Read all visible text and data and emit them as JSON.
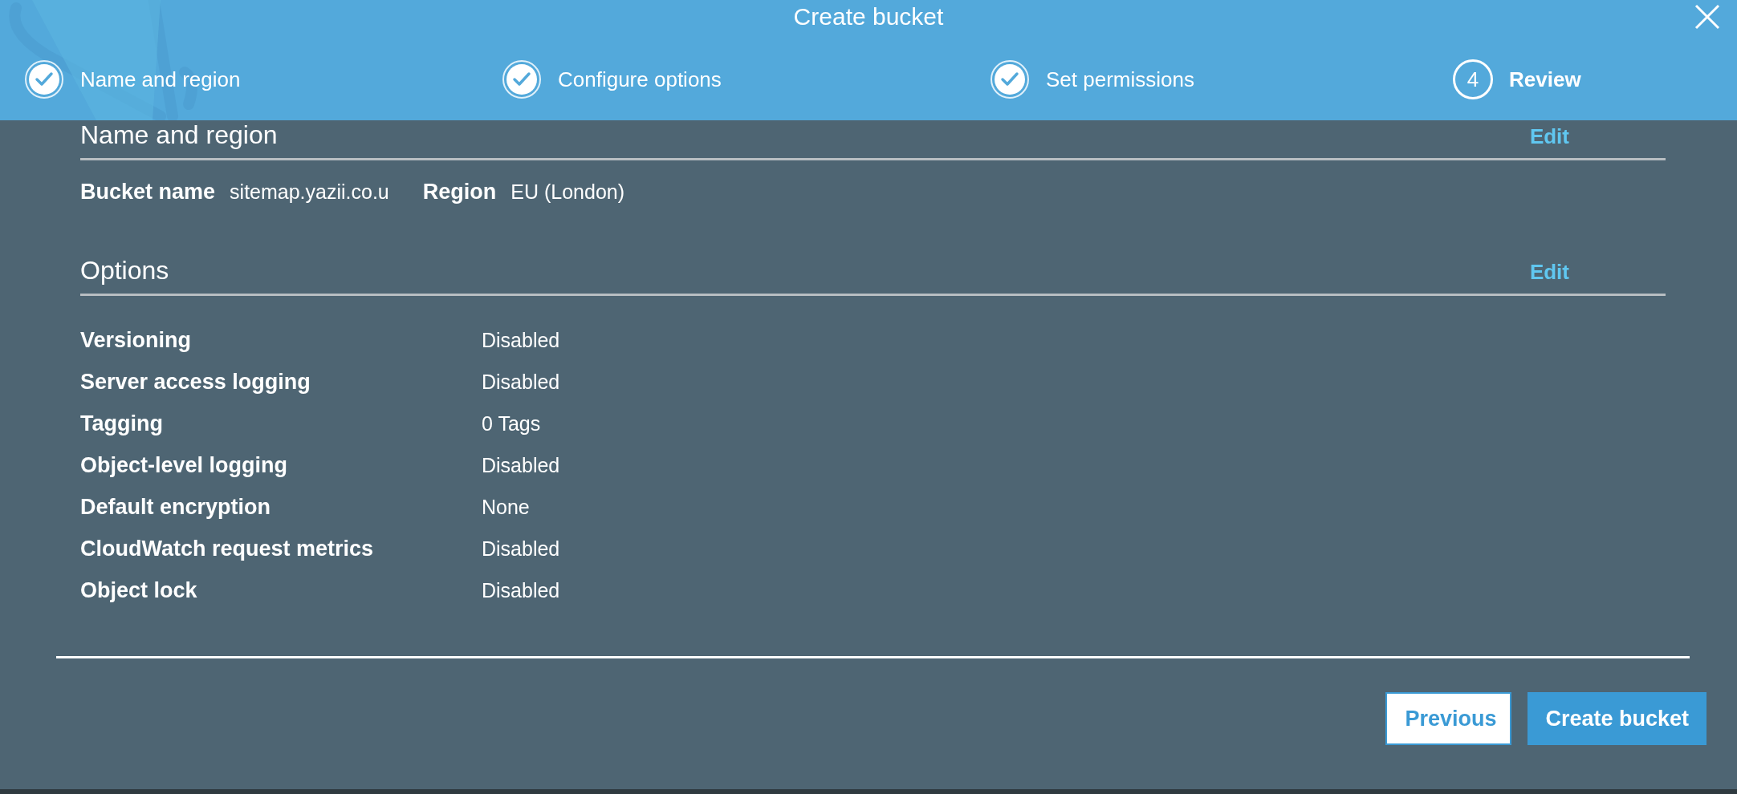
{
  "dialog": {
    "title": "Create bucket"
  },
  "steps": [
    {
      "label": "Name and region",
      "completed": true,
      "selected": false
    },
    {
      "label": "Configure options",
      "completed": true,
      "selected": false
    },
    {
      "label": "Set permissions",
      "completed": true,
      "selected": false
    },
    {
      "label": "Review",
      "completed": false,
      "selected": true,
      "number": "4"
    }
  ],
  "sections": [
    {
      "kind": "inline",
      "heading": "Name and region",
      "edit": "Edit",
      "fields": [
        {
          "label": "Bucket name",
          "value": "sitemap.yazii.co.u"
        },
        {
          "label": "Region",
          "value": "EU (London)"
        }
      ]
    },
    {
      "kind": "table",
      "heading": "Options",
      "edit": "Edit",
      "fields": [
        {
          "label": "Versioning",
          "value": "Disabled"
        },
        {
          "label": "Server access logging",
          "value": "Disabled"
        },
        {
          "label": "Tagging",
          "value": "0 Tags"
        },
        {
          "label": "Object-level logging",
          "value": "Disabled"
        },
        {
          "label": "Default encryption",
          "value": "None"
        },
        {
          "label": "CloudWatch request metrics",
          "value": "Disabled"
        },
        {
          "label": "Object lock",
          "value": "Disabled"
        }
      ]
    }
  ],
  "buttons": [
    {
      "label": "Previous",
      "kind": "secondary"
    },
    {
      "label": "Create bucket",
      "kind": "primary"
    }
  ]
}
